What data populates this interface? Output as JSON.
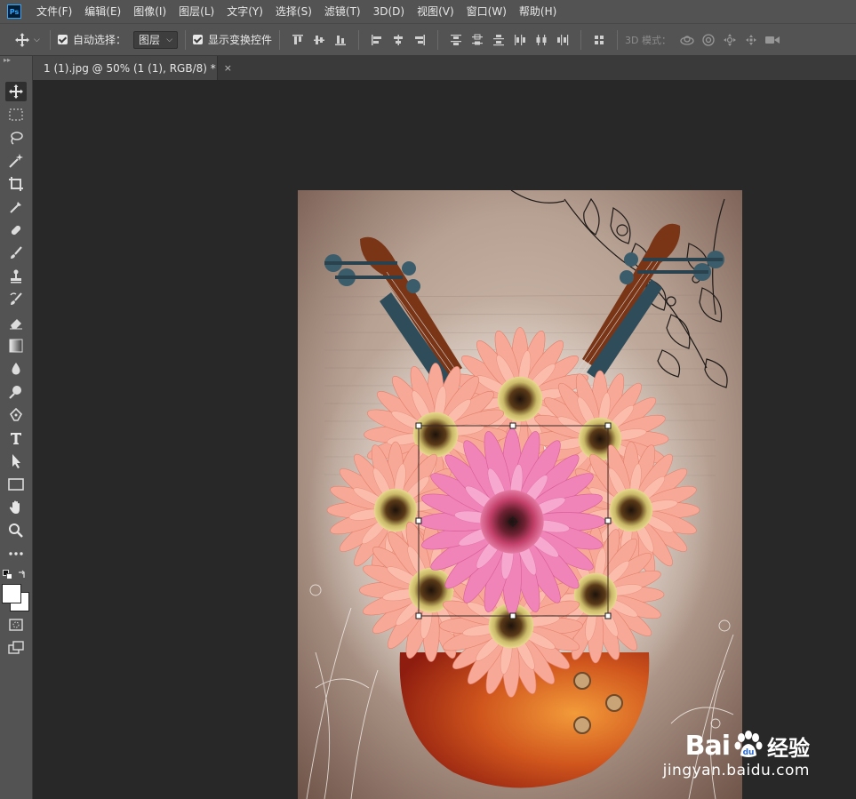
{
  "menubar": {
    "logo": "Ps",
    "items": [
      "文件(F)",
      "编辑(E)",
      "图像(I)",
      "图层(L)",
      "文字(Y)",
      "选择(S)",
      "滤镜(T)",
      "3D(D)",
      "视图(V)",
      "窗口(W)",
      "帮助(H)"
    ]
  },
  "options": {
    "auto_select_label": "自动选择：",
    "auto_select_value": "图层",
    "transform_label": "显示变换控件",
    "mode3d_label": "3D 模式："
  },
  "document": {
    "tab_title": "1 (1).jpg @ 50% (1 (1), RGB/8) *",
    "close_glyph": "×"
  },
  "watermark": {
    "brand": "Bai",
    "suffix": "经验",
    "url": "jingyan.baidu.com"
  },
  "colors": {
    "ui_dark": "#535353",
    "canvas_bg": "#282828",
    "accent": "#31a8ff"
  }
}
